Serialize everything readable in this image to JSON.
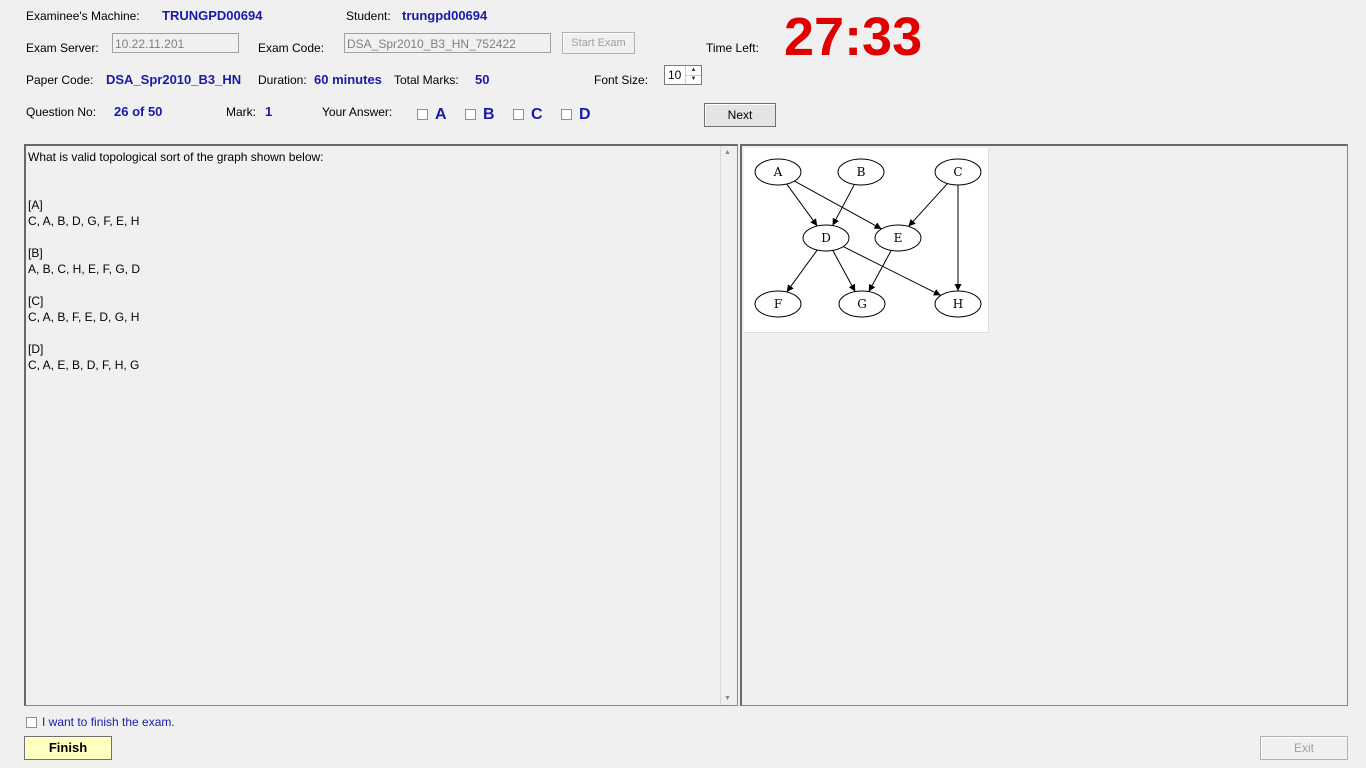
{
  "header": {
    "machine_label": "Examinee's Machine:",
    "machine_value": "TRUNGPD00694",
    "student_label": "Student:",
    "student_value": "trungpd00694",
    "server_label": "Exam Server:",
    "server_value": "10.22.11.201",
    "exam_code_label": "Exam Code:",
    "exam_code_value": "DSA_Spr2010_B3_HN_752422",
    "start_exam_label": "Start Exam",
    "time_left_label": "Time Left:",
    "time_left_value": "27:33",
    "paper_code_label": "Paper Code:",
    "paper_code_value": "DSA_Spr2010_B3_HN",
    "duration_label": "Duration:",
    "duration_value": "60 minutes",
    "total_marks_label": "Total Marks:",
    "total_marks_value": "50",
    "font_size_label": "Font Size:",
    "font_size_value": "10",
    "question_no_label": "Question No:",
    "question_no_value": "26 of 50",
    "mark_label": "Mark:",
    "mark_value": "1",
    "your_answer_label": "Your Answer:",
    "answers": [
      "A",
      "B",
      "C",
      "D"
    ],
    "next_label": "Next"
  },
  "question": {
    "text": "What is valid topological sort of the graph shown below:\n\n\n[A]\nC, A, B, D, G, F, E, H\n\n[B]\nA, B, C, H, E, F, G, D\n\n[C]\nC, A, B, F, E, D, G, H\n\n[D]\nC, A, E, B, D, F, H, G"
  },
  "graph": {
    "nodes": [
      "A",
      "B",
      "C",
      "D",
      "E",
      "F",
      "G",
      "H"
    ],
    "edges": [
      [
        "A",
        "D"
      ],
      [
        "A",
        "E"
      ],
      [
        "B",
        "D"
      ],
      [
        "C",
        "E"
      ],
      [
        "C",
        "H"
      ],
      [
        "D",
        "F"
      ],
      [
        "D",
        "G"
      ],
      [
        "D",
        "H"
      ],
      [
        "E",
        "G"
      ]
    ]
  },
  "footer": {
    "finish_check_label": "I want to finish the exam.",
    "finish_label": "Finish",
    "exit_label": "Exit"
  },
  "colors": {
    "timer": "#e00000",
    "value_blue": "#1a1aaa",
    "finish_button": "#ffffc0"
  }
}
